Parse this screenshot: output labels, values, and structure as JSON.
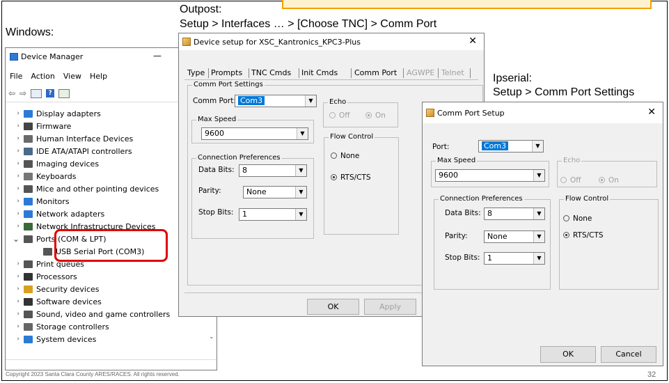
{
  "slide": {
    "footer": "Copyright 2023 Santa Clara County ARES/RACES.  All rights reserved.",
    "page_number": "32"
  },
  "captions": {
    "windows": "Windows:",
    "outpost_title": "Outpost:",
    "outpost_path": "Setup > Interfaces … > [Choose TNC] > Comm Port",
    "ipserial_title": "Ipserial:",
    "ipserial_path": "Setup > Comm Port Settings"
  },
  "device_manager": {
    "title": "Device Manager",
    "min_glyph": "—",
    "max_glyph": "☐",
    "menu": [
      "File",
      "Action",
      "View",
      "Help"
    ],
    "items": [
      {
        "label": "Display adapters",
        "icon": "display-adapter-icon",
        "color": "#2b7bd6"
      },
      {
        "label": "Firmware",
        "icon": "firmware-icon",
        "color": "#444444"
      },
      {
        "label": "Human Interface Devices",
        "icon": "hid-icon",
        "color": "#6a6a6a"
      },
      {
        "label": "IDE ATA/ATAPI controllers",
        "icon": "ide-controller-icon",
        "color": "#4a6a8a"
      },
      {
        "label": "Imaging devices",
        "icon": "imaging-device-icon",
        "color": "#555555"
      },
      {
        "label": "Keyboards",
        "icon": "keyboard-icon",
        "color": "#777777"
      },
      {
        "label": "Mice and other pointing devices",
        "icon": "mouse-icon",
        "color": "#555555"
      },
      {
        "label": "Monitors",
        "icon": "monitor-icon",
        "color": "#2b7bd6"
      },
      {
        "label": "Network adapters",
        "icon": "network-adapter-icon",
        "color": "#2b7bd6"
      },
      {
        "label": "Network Infrastructure Devices",
        "icon": "network-infrastructure-icon",
        "color": "#3a6a3a"
      },
      {
        "label": "Ports (COM & LPT)",
        "icon": "port-icon",
        "color": "#555555",
        "expanded": true
      },
      {
        "label": "USB Serial Port (COM3)",
        "icon": "usb-serial-port-icon",
        "color": "#555555",
        "child": true
      },
      {
        "label": "Print queues",
        "icon": "printer-icon",
        "color": "#555555"
      },
      {
        "label": "Processors",
        "icon": "processor-icon",
        "color": "#333333"
      },
      {
        "label": "Security devices",
        "icon": "security-device-icon",
        "color": "#d8a020"
      },
      {
        "label": "Software devices",
        "icon": "software-device-icon",
        "color": "#333333"
      },
      {
        "label": "Sound, video and game controllers",
        "icon": "sound-icon",
        "color": "#555555"
      },
      {
        "label": "Storage controllers",
        "icon": "storage-controller-icon",
        "color": "#666666"
      },
      {
        "label": "System devices",
        "icon": "system-device-icon",
        "color": "#2b7bd6"
      }
    ]
  },
  "outpost": {
    "title": "Device setup for XSC_Kantronics_KPC3-Plus",
    "close": "✕",
    "tabs": [
      "Type",
      "Prompts",
      "TNC Cmds",
      "Init Cmds",
      "Comm Port",
      "AGWPE",
      "Telnet"
    ],
    "active_tab": "Comm Port",
    "group_comm": "Comm Port Settings",
    "comm_port_label": "Comm Port:",
    "comm_port_value": "Com3",
    "group_speed": "Max Speed",
    "speed_value": "9600",
    "group_conn": "Connection Preferences",
    "data_bits_label": "Data Bits:",
    "data_bits_value": "8",
    "parity_label": "Parity:",
    "parity_value": "None",
    "stop_bits_label": "Stop Bits:",
    "stop_bits_value": "1",
    "group_echo": "Echo",
    "echo_off": "Off",
    "echo_on": "On",
    "group_flow": "Flow Control",
    "flow_none": "None",
    "flow_rts": "RTS/CTS",
    "ok": "OK",
    "apply": "Apply"
  },
  "ipserial": {
    "title": "Comm Port Setup",
    "close": "✕",
    "port_label": "Port:",
    "port_value": "Com3",
    "group_speed": "Max Speed",
    "speed_value": "9600",
    "group_echo": "Echo",
    "echo_off": "Off",
    "echo_on": "On",
    "group_conn": "Connection Preferences",
    "data_bits_label": "Data Bits:",
    "data_bits_value": "8",
    "parity_label": "Parity:",
    "parity_value": "None",
    "stop_bits_label": "Stop Bits:",
    "stop_bits_value": "1",
    "group_flow": "Flow Control",
    "flow_none": "None",
    "flow_rts": "RTS/CTS",
    "ok": "OK",
    "cancel": "Cancel"
  },
  "colors": {
    "highlight": "#e00000",
    "selection": "#0078d7",
    "note_fill": "#fff2cc",
    "note_border": "#f2a000"
  }
}
